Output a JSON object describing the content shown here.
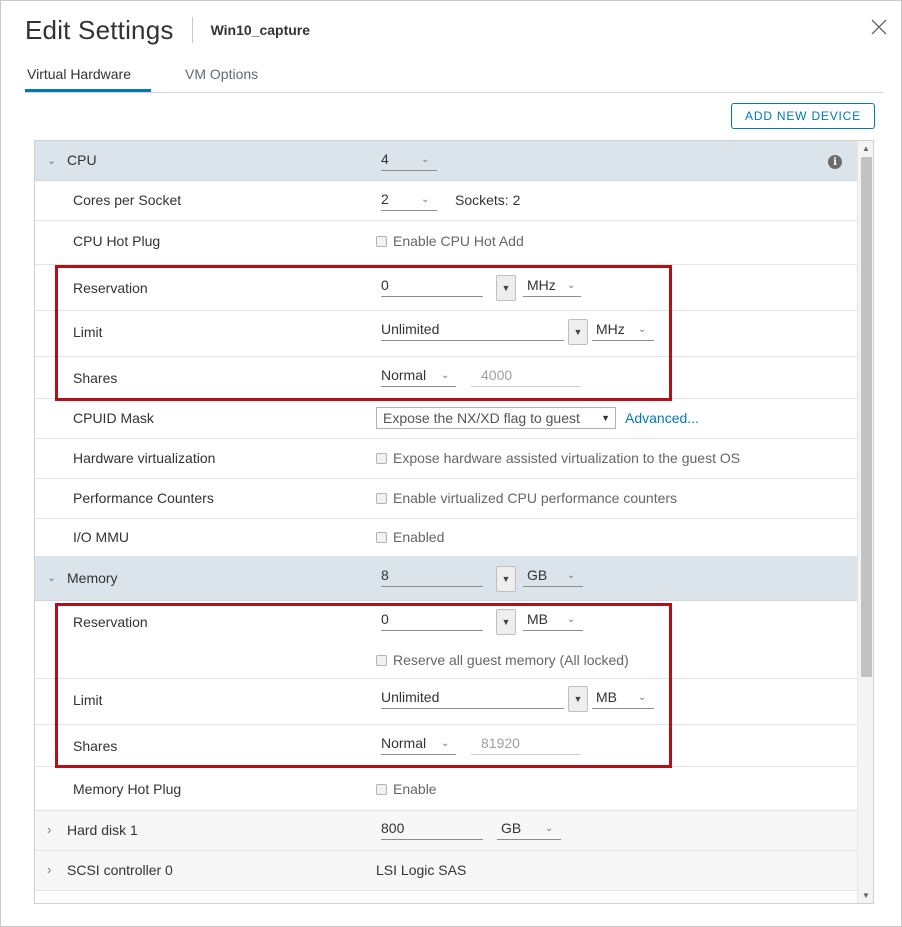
{
  "dialog": {
    "title": "Edit Settings",
    "vm_name": "Win10_capture"
  },
  "tabs": [
    {
      "label": "Virtual Hardware",
      "active": true
    },
    {
      "label": "VM Options",
      "active": false
    }
  ],
  "add_device_label": "ADD NEW DEVICE",
  "cpu": {
    "label": "CPU",
    "count": "4",
    "cores_label": "Cores per Socket",
    "cores_value": "2",
    "sockets_text": "Sockets: 2",
    "hotplug_label": "CPU Hot Plug",
    "hotplug_checkbox": "Enable CPU Hot Add",
    "reservation_label": "Reservation",
    "reservation_value": "0",
    "reservation_unit": "MHz",
    "limit_label": "Limit",
    "limit_value": "Unlimited",
    "limit_unit": "MHz",
    "shares_label": "Shares",
    "shares_level": "Normal",
    "shares_value": "4000",
    "cpuid_label": "CPUID Mask",
    "cpuid_value": "Expose the NX/XD flag to guest",
    "cpuid_advanced": "Advanced...",
    "hwvirt_label": "Hardware virtualization",
    "hwvirt_checkbox": "Expose hardware assisted virtualization to the guest OS",
    "perf_label": "Performance Counters",
    "perf_checkbox": "Enable virtualized CPU performance counters",
    "iommu_label": "I/O MMU",
    "iommu_checkbox": "Enabled"
  },
  "memory": {
    "label": "Memory",
    "value": "8",
    "unit": "GB",
    "reservation_label": "Reservation",
    "reservation_value": "0",
    "reservation_unit": "MB",
    "reserve_all_checkbox": "Reserve all guest memory (All locked)",
    "limit_label": "Limit",
    "limit_value": "Unlimited",
    "limit_unit": "MB",
    "shares_label": "Shares",
    "shares_level": "Normal",
    "shares_value": "81920",
    "hotplug_label": "Memory Hot Plug",
    "hotplug_checkbox": "Enable"
  },
  "hard_disk": {
    "label": "Hard disk 1",
    "value": "800",
    "unit": "GB"
  },
  "scsi": {
    "label": "SCSI controller 0",
    "value": "LSI Logic SAS"
  },
  "colors": {
    "accent": "#0079b8",
    "section_bg": "#dbe4ea",
    "highlight": "#b3101a"
  }
}
